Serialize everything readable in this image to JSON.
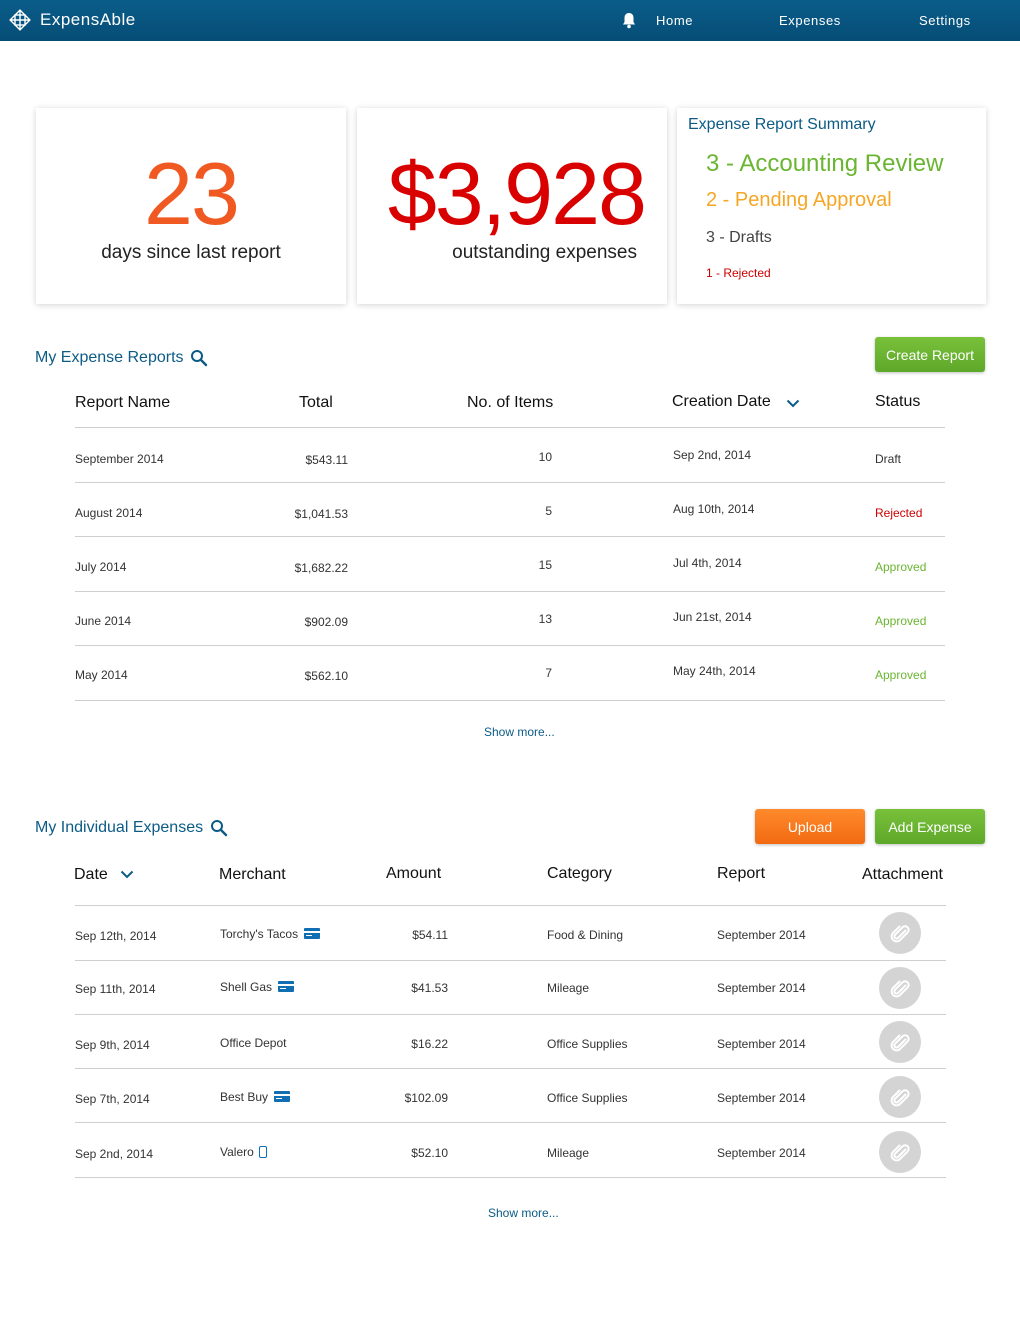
{
  "app": {
    "name": "ExpensAble"
  },
  "nav": {
    "home": "Home",
    "expenses": "Expenses",
    "settings": "Settings"
  },
  "stats": {
    "days": {
      "value": "23",
      "label": "days since last report",
      "color": "#f05a22"
    },
    "outstanding": {
      "value": "$3,928",
      "label": "outstanding expenses",
      "color": "#d90000"
    }
  },
  "summary": {
    "title": "Expense Report Summary",
    "accounting": "3 - Accounting Review",
    "pending": "2 - Pending Approval",
    "drafts": "3 - Drafts",
    "rejected": "1 - Rejected",
    "colors": {
      "accounting": "#6ab531",
      "pending": "#f6a623",
      "drafts": "#444444",
      "rejected": "#cc0000"
    }
  },
  "reports": {
    "title": "My Expense Reports",
    "create_button": "Create Report",
    "columns": {
      "name": "Report Name",
      "total": "Total",
      "items": "No. of Items",
      "date": "Creation Date",
      "status": "Status"
    },
    "rows": [
      {
        "name": "September 2014",
        "total": "$543.11",
        "items": "10",
        "date": "Sep 2nd, 2014",
        "status": "Draft"
      },
      {
        "name": "August 2014",
        "total": "$1,041.53",
        "items": "5",
        "date": "Aug 10th, 2014",
        "status": "Rejected"
      },
      {
        "name": "July 2014",
        "total": "$1,682.22",
        "items": "15",
        "date": "Jul 4th, 2014",
        "status": "Approved"
      },
      {
        "name": "June 2014",
        "total": "$902.09",
        "items": "13",
        "date": "Jun 21st, 2014",
        "status": "Approved"
      },
      {
        "name": "May 2014",
        "total": "$562.10",
        "items": "7",
        "date": "May 24th, 2014",
        "status": "Approved"
      }
    ],
    "show_more": "Show more..."
  },
  "expenses": {
    "title": "My Individual Expenses",
    "upload_button": "Upload",
    "add_button": "Add Expense",
    "columns": {
      "date": "Date",
      "merchant": "Merchant",
      "amount": "Amount",
      "category": "Category",
      "report": "Report",
      "attachment": "Attachment"
    },
    "rows": [
      {
        "date": "Sep 12th, 2014",
        "merchant": "Torchy's Tacos",
        "payment_icon": "credit-card-icon",
        "amount": "$54.11",
        "category": "Food & Dining",
        "report": "September 2014"
      },
      {
        "date": "Sep 11th, 2014",
        "merchant": "Shell Gas",
        "payment_icon": "credit-card-icon",
        "amount": "$41.53",
        "category": "Mileage",
        "report": "September 2014"
      },
      {
        "date": "Sep 9th, 2014",
        "merchant": "Office Depot",
        "payment_icon": "",
        "amount": "$16.22",
        "category": "Office Supplies",
        "report": "September 2014"
      },
      {
        "date": "Sep 7th, 2014",
        "merchant": "Best Buy",
        "payment_icon": "credit-card-icon",
        "amount": "$102.09",
        "category": "Office Supplies",
        "report": "September 2014"
      },
      {
        "date": "Sep 2nd, 2014",
        "merchant": "Valero",
        "payment_icon": "mobile-phone-icon",
        "amount": "$52.10",
        "category": "Mileage",
        "report": "September 2014"
      }
    ],
    "show_more": "Show more..."
  }
}
